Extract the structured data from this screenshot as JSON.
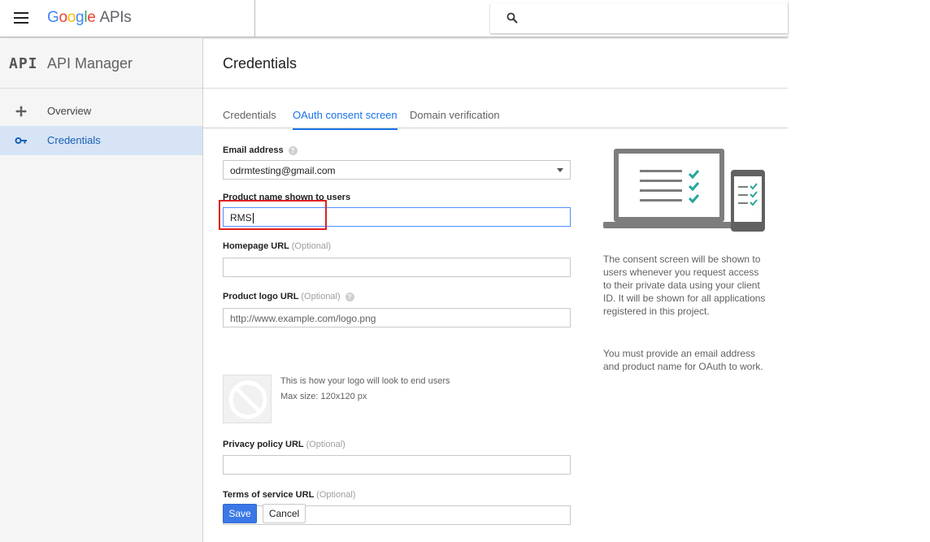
{
  "topbar": {
    "logo_letters": [
      "G",
      "o",
      "o",
      "g",
      "l",
      "e"
    ],
    "logo_suffix": "APIs",
    "search": {
      "value": "",
      "placeholder": ""
    }
  },
  "sidebar": {
    "glyph": "API",
    "title": "API Manager",
    "items": [
      {
        "label": "Overview",
        "icon": "overview-diamond-icon",
        "active": false
      },
      {
        "label": "Credentials",
        "icon": "key-icon",
        "active": true
      }
    ]
  },
  "main": {
    "title": "Credentials",
    "tabs": [
      {
        "label": "Credentials",
        "active": false
      },
      {
        "label": "OAuth consent screen",
        "active": true
      },
      {
        "label": "Domain verification",
        "active": false
      }
    ]
  },
  "form": {
    "email": {
      "label": "Email address",
      "value": "odrmtesting@gmail.com"
    },
    "product_name": {
      "label": "Product name shown to users",
      "value": "RMS"
    },
    "homepage": {
      "label": "Homepage URL",
      "optional": "(Optional)",
      "value": ""
    },
    "logo_url": {
      "label": "Product logo URL",
      "optional": "(Optional)",
      "value": "",
      "placeholder": "http://www.example.com/logo.png"
    },
    "logo_hint": {
      "line1": "This is how your logo will look to end users",
      "line2": "Max size: 120x120 px"
    },
    "privacy": {
      "label": "Privacy policy URL",
      "optional": "(Optional)",
      "value": ""
    },
    "terms": {
      "label": "Terms of service URL",
      "optional": "(Optional)",
      "value": ""
    },
    "save_label": "Save",
    "cancel_label": "Cancel"
  },
  "info": {
    "paragraph1": "The consent screen will be shown to users whenever you request access to their private data using your client ID. It will be shown for all applications registered in this project.",
    "paragraph2": "You must provide an email address and product name for OAuth to work."
  },
  "colors": {
    "accent": "#1a73e8",
    "save_button": "#3b78e7",
    "highlight": "#e02020",
    "active_nav_bg": "#d6e4f5"
  }
}
